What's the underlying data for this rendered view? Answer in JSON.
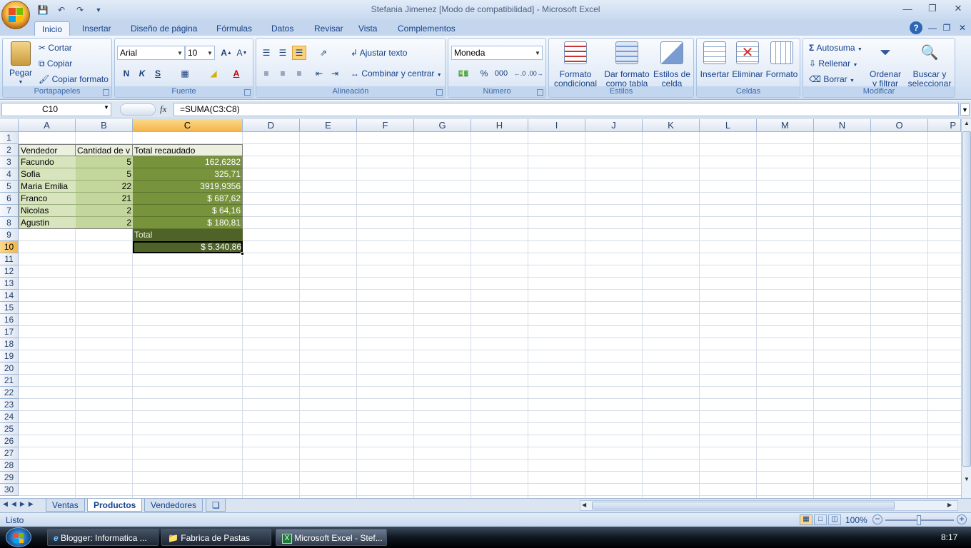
{
  "window": {
    "title": "Stefania Jimenez  [Modo de compatibilidad] - Microsoft Excel"
  },
  "ribbon_tabs": [
    "Inicio",
    "Insertar",
    "Diseño de página",
    "Fórmulas",
    "Datos",
    "Revisar",
    "Vista",
    "Complementos"
  ],
  "ribbon": {
    "portapapeles": {
      "label": "Portapapeles",
      "paste": "Pegar",
      "cut": "Cortar",
      "copy": "Copiar",
      "format_painter": "Copiar formato"
    },
    "fuente": {
      "label": "Fuente",
      "font_name": "Arial",
      "font_size": "10",
      "bold": "N",
      "italic": "K",
      "underline": "S"
    },
    "alineacion": {
      "label": "Alineación",
      "wrap": "Ajustar texto",
      "merge": "Combinar y centrar"
    },
    "numero": {
      "label": "Número",
      "format": "Moneda",
      "percent": "%",
      "thousands": "000"
    },
    "estilos": {
      "label": "Estilos",
      "cond_l1": "Formato",
      "cond_l2": "condicional",
      "table_l1": "Dar formato",
      "table_l2": "como tabla",
      "cell_l1": "Estilos de",
      "cell_l2": "celda"
    },
    "celdas": {
      "label": "Celdas",
      "insert": "Insertar",
      "delete": "Eliminar",
      "format": "Formato"
    },
    "modificar": {
      "label": "Modificar",
      "autosum": "Autosuma",
      "fill": "Rellenar",
      "clear": "Borrar",
      "sort_l1": "Ordenar",
      "sort_l2": "y filtrar",
      "find_l1": "Buscar y",
      "find_l2": "seleccionar"
    }
  },
  "formula_bar": {
    "name_box": "C10",
    "fx": "fx",
    "formula": "=SUMA(C3:C8)"
  },
  "columns": [
    "A",
    "B",
    "C",
    "D",
    "E",
    "F",
    "G",
    "H",
    "I",
    "J",
    "K",
    "L",
    "M",
    "N",
    "O",
    "P"
  ],
  "rows": [
    "1",
    "2",
    "3",
    "4",
    "5",
    "6",
    "7",
    "8",
    "9",
    "10",
    "11",
    "12",
    "13",
    "14",
    "15",
    "16",
    "17",
    "18",
    "19",
    "20",
    "21",
    "22",
    "23",
    "24",
    "25",
    "26",
    "27",
    "28",
    "29",
    "30"
  ],
  "table": {
    "headers": [
      "Vendedor",
      "Cantidad de v",
      "Total recaudado"
    ],
    "rows": [
      [
        "Facundo",
        "5",
        "162,6282"
      ],
      [
        "Sofia",
        "5",
        "325,71"
      ],
      [
        "Maria Emilia",
        "22",
        "3919,9356"
      ],
      [
        "Franco",
        "21",
        "$ 687,62"
      ],
      [
        "Nicolas",
        "2",
        "$ 64,16"
      ],
      [
        "Agustin",
        "2",
        "$ 180,81"
      ]
    ],
    "total_label": "Total",
    "total_value": "$ 5.340,86"
  },
  "sheets": [
    "Ventas",
    "Productos",
    "Vendedores"
  ],
  "status": {
    "ready": "Listo",
    "zoom": "100%"
  },
  "taskbar": {
    "items": [
      "Blogger: Informatica ...",
      "Fabrica de Pastas",
      "Microsoft Excel - Stef..."
    ],
    "clock": "8:17"
  },
  "colors": {
    "header_fill": "#ebf1de",
    "vendedor_fill": "#d7e4bd",
    "cantidad_fill": "#c3d69b",
    "total_fill": "#77933c",
    "total_label_fill": "#4f6228",
    "selected_header": "#f5b54c"
  }
}
